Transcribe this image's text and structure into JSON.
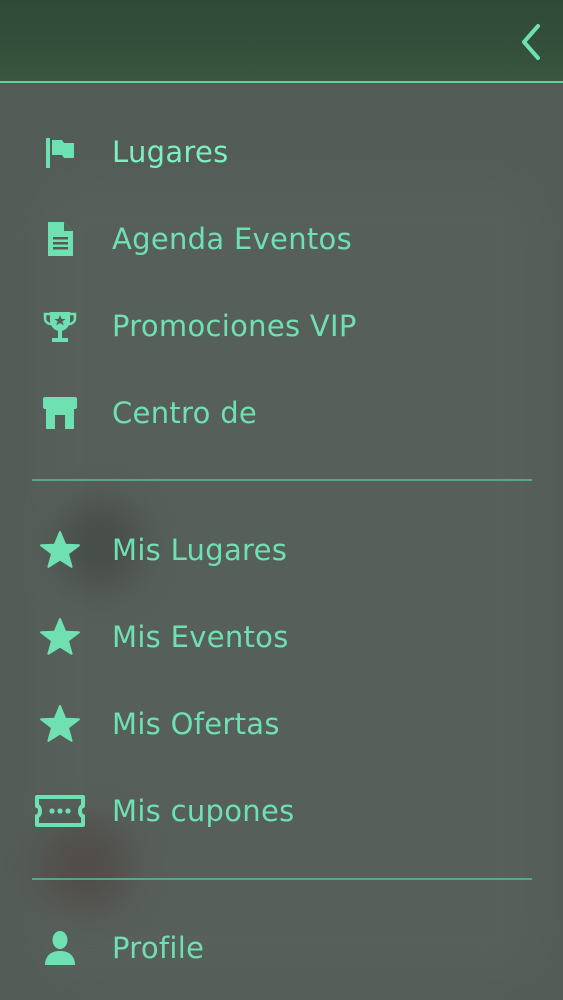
{
  "colors": {
    "accent": "#6fe0b2",
    "header_bg": "#34503b",
    "drawer_bg": "#545c58",
    "divider": "#5fbf95"
  },
  "header": {
    "back_icon": "chevron-left-icon"
  },
  "menu": {
    "section1": [
      {
        "label": "Lugares",
        "icon": "flag-icon"
      },
      {
        "label": "Agenda Eventos",
        "icon": "document-icon"
      },
      {
        "label": "Promociones VIP",
        "icon": "trophy-icon"
      },
      {
        "label": "Centro de",
        "icon": "store-icon"
      }
    ],
    "section2": [
      {
        "label": "Mis Lugares",
        "icon": "star-icon"
      },
      {
        "label": "Mis Eventos",
        "icon": "star-icon"
      },
      {
        "label": "Mis Ofertas",
        "icon": "star-icon"
      },
      {
        "label": "Mis cupones",
        "icon": "ticket-icon"
      }
    ],
    "section3": [
      {
        "label": "Profile",
        "icon": "user-icon"
      }
    ]
  }
}
